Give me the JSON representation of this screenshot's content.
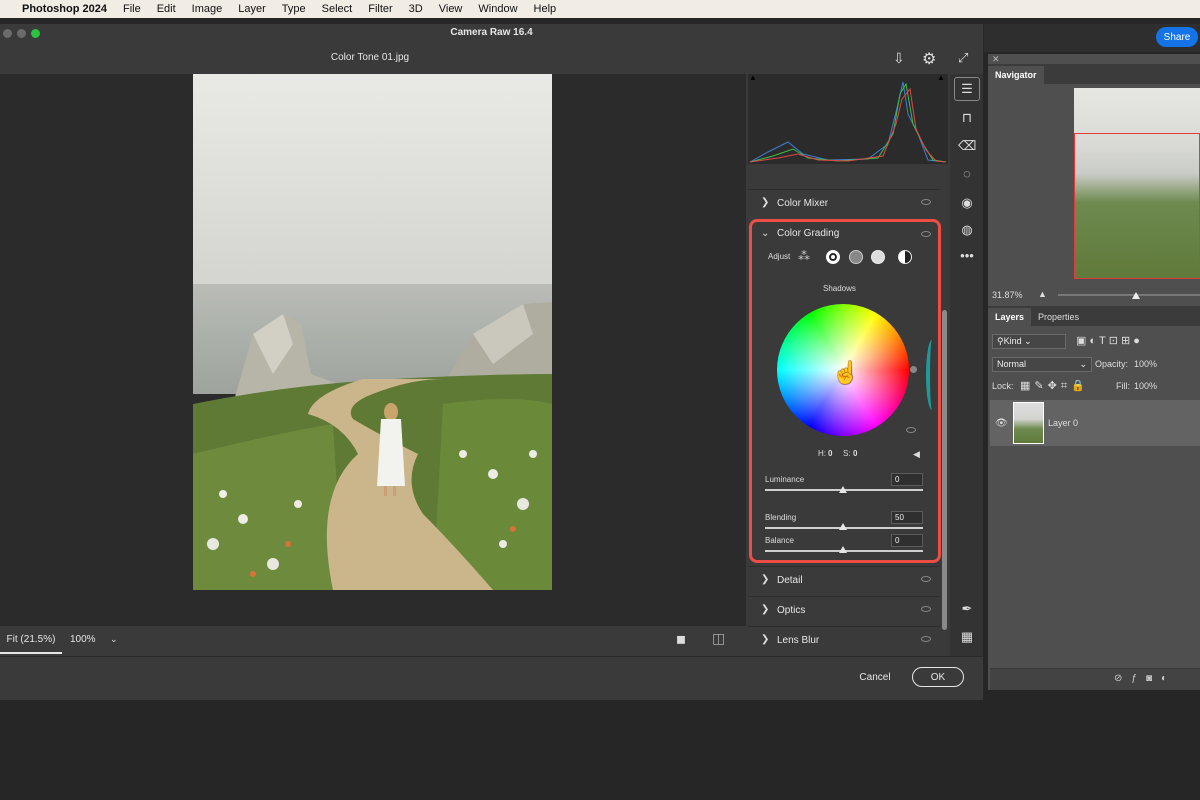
{
  "menubar": {
    "app_name": "Photoshop 2024",
    "menus": [
      "File",
      "Edit",
      "Image",
      "Layer",
      "Type",
      "Select",
      "Filter",
      "3D",
      "View",
      "Window",
      "Help"
    ]
  },
  "photoshop": {
    "share_label": "Share",
    "navigator": {
      "tab": "Navigator",
      "zoom": "31.87%"
    },
    "layers": {
      "tabs": [
        "Layers",
        "Properties"
      ],
      "kind_filter": "Kind",
      "blend_mode": "Normal",
      "opacity_label": "Opacity:",
      "opacity_value": "100%",
      "lock_label": "Lock:",
      "fill_label": "Fill:",
      "fill_value": "100%",
      "layer_name": "Layer 0"
    }
  },
  "camera_raw": {
    "window_title": "Camera Raw 16.4",
    "file_name": "Color Tone 01.jpg",
    "zoom_fit": "Fit (21.5%)",
    "zoom_100": "100%",
    "cancel_label": "Cancel",
    "ok_label": "OK",
    "sections": {
      "color_mixer": "Color Mixer",
      "color_grading": "Color Grading",
      "detail": "Detail",
      "optics": "Optics",
      "lens_blur": "Lens Blur"
    },
    "color_grading": {
      "adjust_label": "Adjust",
      "wheel_label": "Shadows",
      "h_label": "H:",
      "h_value": "0",
      "s_label": "S:",
      "s_value": "0",
      "luminance_label": "Luminance",
      "luminance_value": "0",
      "blending_label": "Blending",
      "blending_value": "50",
      "balance_label": "Balance",
      "balance_value": "0"
    }
  }
}
